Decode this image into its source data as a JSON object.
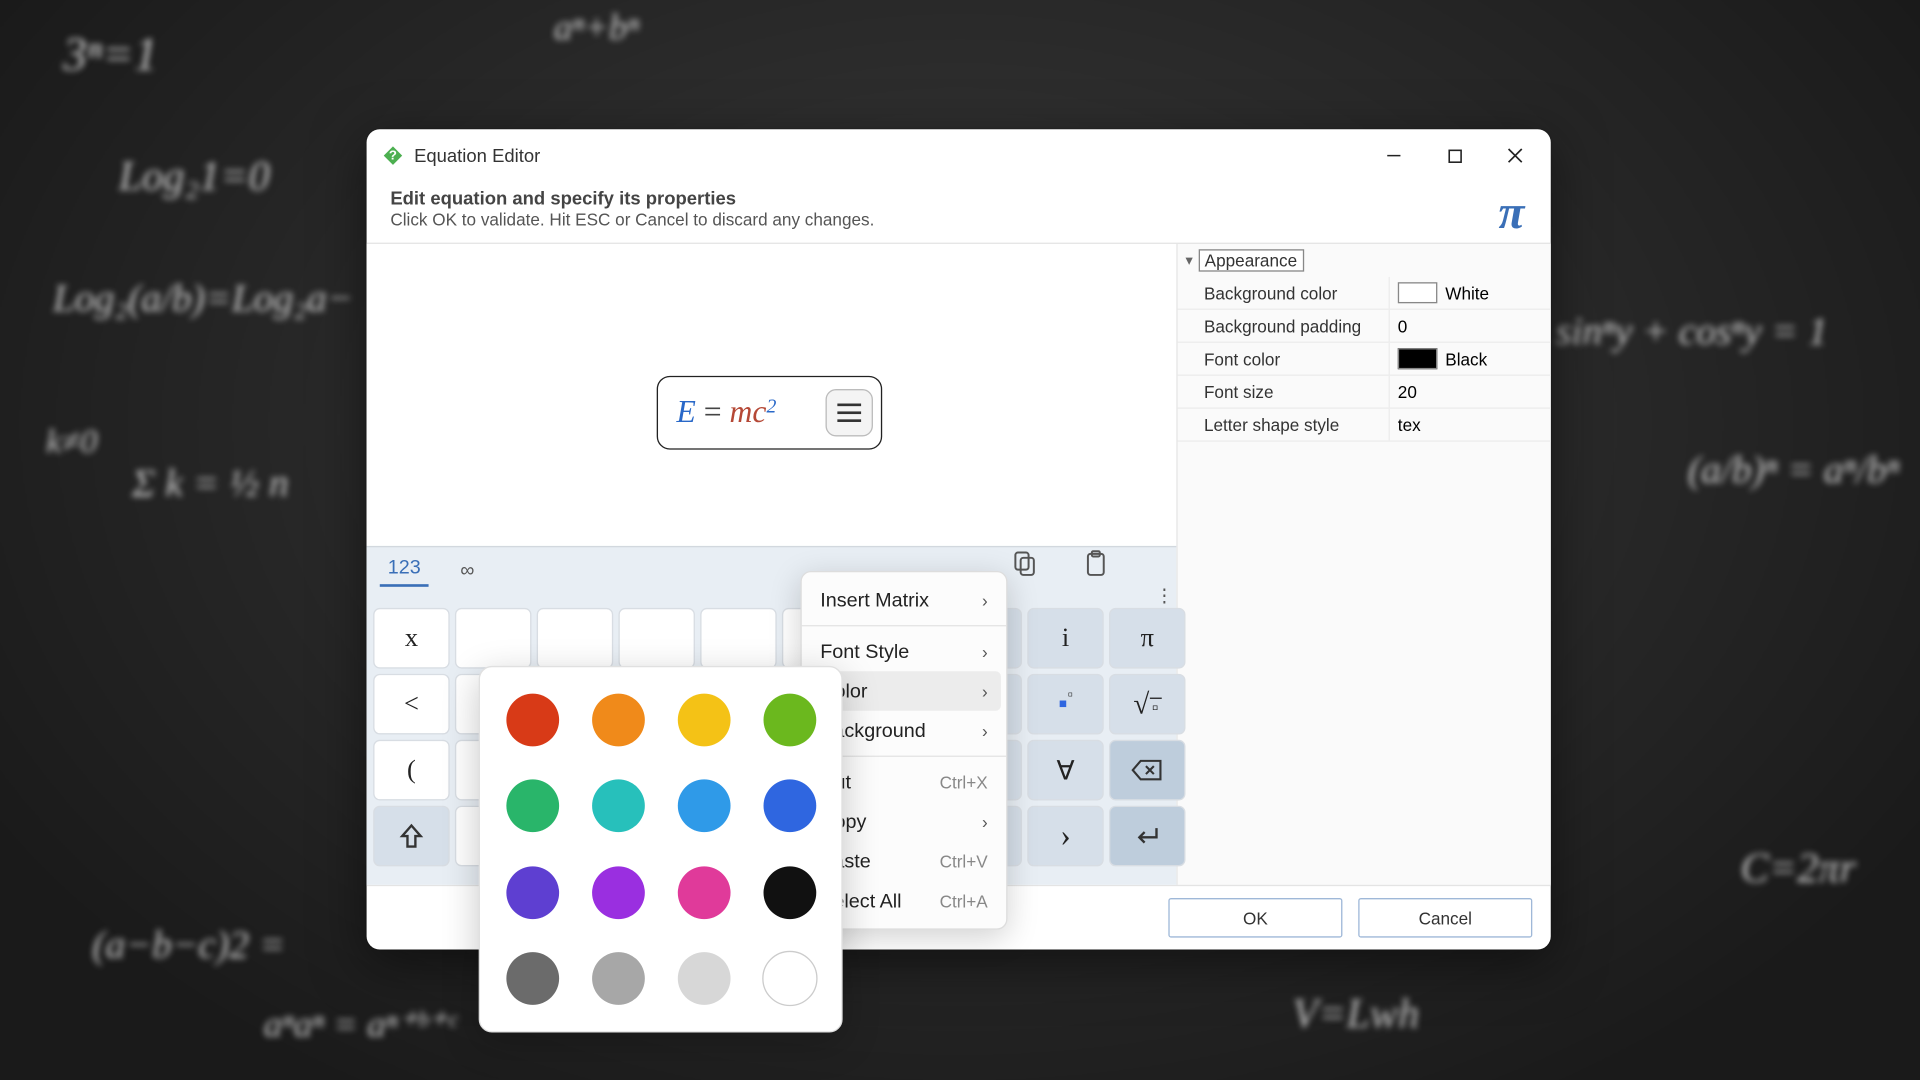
{
  "window": {
    "title": "Equation Editor",
    "header_title": "Edit equation and specify its properties",
    "header_sub": "Click OK to validate. Hit ESC or Cancel to discard any changes.",
    "pi": "π"
  },
  "equation": {
    "E": "E",
    "eq": "=",
    "m": "m",
    "c": "c",
    "sup": "2"
  },
  "props": {
    "section": "Appearance",
    "rows": [
      {
        "name": "Background color",
        "value": "White",
        "swatch": "#ffffff"
      },
      {
        "name": "Background padding",
        "value": "0"
      },
      {
        "name": "Font color",
        "value": "Black",
        "swatch": "#000000"
      },
      {
        "name": "Font size",
        "value": "20"
      },
      {
        "name": "Letter shape style",
        "value": "tex"
      }
    ]
  },
  "footer": {
    "ok": "OK",
    "cancel": "Cancel"
  },
  "tabs": {
    "num": "123",
    "inf": "∞"
  },
  "menu": {
    "insert_matrix": "Insert Matrix",
    "font_style": "Font Style",
    "color": "Color",
    "background": "Background",
    "cut": "Cut",
    "cut_sc": "Ctrl+X",
    "copy": "Copy",
    "paste": "Paste",
    "paste_sc": "Ctrl+V",
    "select_all": "Select All",
    "select_all_sc": "Ctrl+A"
  },
  "colors": [
    "#d83a17",
    "#f08a1a",
    "#f4c216",
    "#6bb81e",
    "#29b56a",
    "#27c0bb",
    "#2f9ae8",
    "#2f66e0",
    "#5e3fd1",
    "#9a2fe0",
    "#e03a9a",
    "#111111",
    "#6b6b6b",
    "#a7a7a7",
    "#d7d7d7",
    "#ffffff"
  ],
  "keys": {
    "r1": [
      "x",
      "",
      "",
      "",
      "",
      "",
      "",
      "",
      "i",
      "π"
    ],
    "r2": [
      "<",
      "",
      "",
      "",
      "",
      "",
      "",
      "",
      "▫◦",
      "√▫"
    ],
    "r3": [
      "(",
      "",
      "",
      "",
      "",
      "",
      "",
      "",
      "∀",
      "⌫"
    ],
    "r4": [
      "⇧",
      "",
      "",
      "",
      "",
      "+",
      "",
      "‹",
      "›",
      "↵"
    ]
  },
  "chalk": {
    "a": "3ⁿ=1",
    "b": "Log₂1=0",
    "c": "Log₂(a/b)=Log₂a−",
    "d": "k≠0",
    "e": "Σ k = ½ n",
    "f": "aⁿ+bⁿ",
    "g": "sinⁿy + cosⁿy = 1",
    "h": "(a/b)ⁿ = aⁿ/bⁿ",
    "i": "C=2πr",
    "j": "V=Lwh",
    "k": "(a−b−c)2 =",
    "l": "aⁿaⁿ = aⁿ⁺ᵇ⁺ᶜ"
  }
}
